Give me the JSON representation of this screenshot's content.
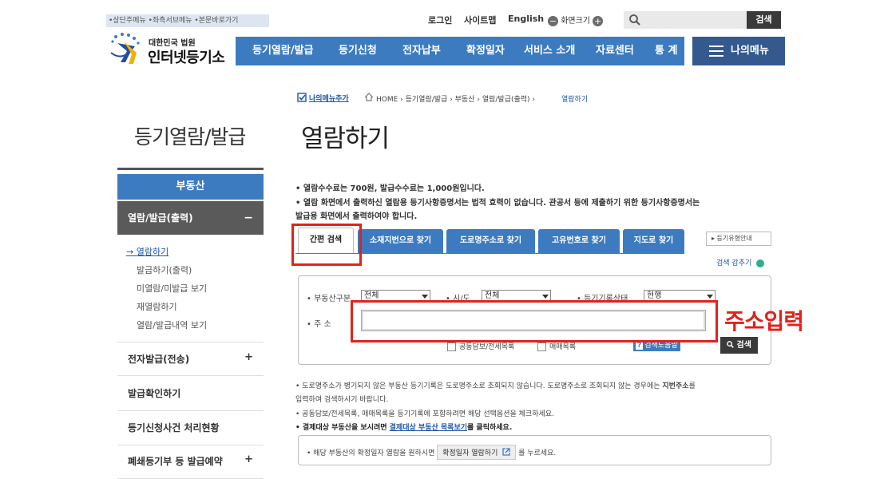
{
  "header": {
    "skip_links": "•상단주메뉴 •좌측서브메뉴 •본문바로가기",
    "login": "로그인",
    "sitemap": "사이트맵",
    "english": "English",
    "zoom_label": "화면크기",
    "zoom_minus": "−",
    "zoom_plus": "+",
    "search_placeholder": "",
    "search_button": "검색",
    "logo_small": "대한민국 법원",
    "logo_big": "인터넷등기소"
  },
  "gnb": {
    "items": [
      "등기열람/발급",
      "등기신청",
      "전자납부",
      "확정일자",
      "서비스 소개",
      "자료센터",
      "통 계"
    ],
    "my_menu": "나의메뉴"
  },
  "breadcrumb": {
    "add_my_menu": "나의메뉴추가",
    "path": "HOME › 등기열람/발급 › 부동산 › 열람/발급(출력) ›",
    "current": "열람하기"
  },
  "sidebar": {
    "title": "등기열람/발급",
    "section": "부동산",
    "active_group": "열람/발급(출력)",
    "active_sign": "−",
    "sub_items": [
      "→ 열람하기",
      "발급하기(출력)",
      "미열람/미발급 보기",
      "재열람하기",
      "열람/발급내역 보기"
    ],
    "items": [
      {
        "label": "전자발급(전송)",
        "sign": "+"
      },
      {
        "label": "발급확인하기",
        "sign": ""
      },
      {
        "label": "등기신청사건 처리현황",
        "sign": ""
      },
      {
        "label": "폐쇄등기부 등 발급예약",
        "sign": "+"
      }
    ]
  },
  "page": {
    "title": "열람하기",
    "notices": [
      "• 열람수수료는 700원, 발급수수료는 1,000원입니다.",
      "• 열람 화면에서 출력하신 열람용 등기사항증명서는 법적 효력이 없습니다. 관공서 등에 제출하기 위한 등기사항증명서는",
      "  발급용 화면에서 출력하여야 합니다."
    ]
  },
  "tabs": {
    "items": [
      "간편 검색",
      "소재지번으로 찾기",
      "도로명주소로 찾기",
      "고유번호로 찾기",
      "지도로 찾기"
    ],
    "guide_button": "▸ 등기유형안내",
    "collapse": "검색 감추기"
  },
  "search_form": {
    "property_type_label": "• 부동산구분",
    "property_type_value": "전체",
    "city_label": "• 시/도",
    "city_value": "전체",
    "record_status_label": "• 등기기록상태",
    "record_status_value": "현행",
    "address_label": "• 주 소",
    "address_value": "",
    "address_placeholder": "",
    "checkbox1": "공동담보/전세목록",
    "checkbox2": "매매목록",
    "help_icon": "?",
    "help_label": "검색도움말",
    "search_button": "검색"
  },
  "annotation": {
    "label": "주소입력",
    "color": "#e0231a"
  },
  "bottom_notes": {
    "line1a": "• 도로명주소가 병기되지 않은 부동산 등기기록은 도로명주소로 조회되지 않습니다. 도로명주소로 조회되지 않는 경우에는 ",
    "line1b": "지번주소",
    "line1c": "를",
    "line2": "  입력하여 검색하시기 바랍니다.",
    "line3": "• 공동담보/전세목록, 매매목록을 등기기록에 포함하려면 해당 선택옵션을 체크하세요.",
    "line4a": "• 결제대상 부동산을 보시려면 ",
    "line4b": "결제대상 부동산 목록보기",
    "line4c": "를 클릭하세요.",
    "info_text": "• 해당 부동산의 확정일자 열람을 원하시면",
    "info_button": "확정일자 열람하기",
    "info_suffix": "를 누르세요."
  },
  "colors": {
    "primary_blue": "#3d7bc0",
    "dark_blue": "#33598e",
    "red": "#e0231a"
  }
}
